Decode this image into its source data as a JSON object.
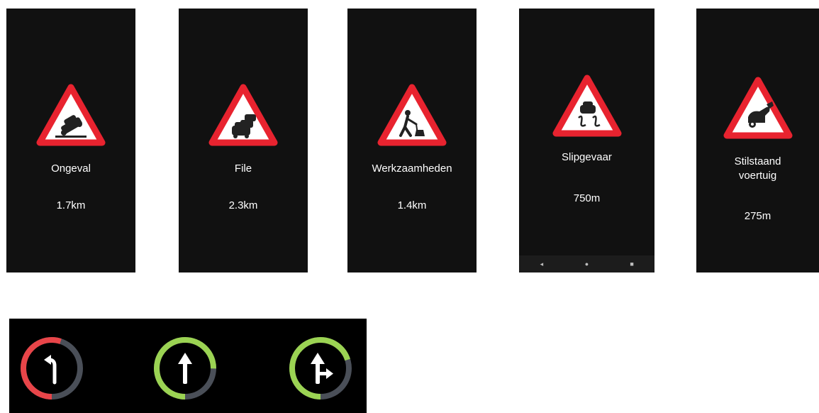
{
  "colors": {
    "card_bg": "#111111",
    "sign_red": "#e8232f",
    "ring_red": "#e84549",
    "ring_green": "#9bd353",
    "ring_track": "#4a4f58"
  },
  "warnings": [
    {
      "label": "Ongeval",
      "distance": "1.7km",
      "icon": "car-crash-icon"
    },
    {
      "label": "File",
      "distance": "2.3km",
      "icon": "traffic-jam-icon"
    },
    {
      "label": "Werkzaamheden",
      "distance": "1.4km",
      "icon": "roadworks-icon"
    },
    {
      "label": "Slipgevaar",
      "distance": "750m",
      "icon": "slippery-road-icon"
    },
    {
      "label": "Stilstaand\nvoertuig",
      "distance": "275m",
      "icon": "stationary-vehicle-icon"
    }
  ],
  "android_nav": {
    "back": "◂",
    "home": "●",
    "recents": "■"
  },
  "turn_indicators": [
    {
      "icon": "turn-left-arrow-icon",
      "ring_color": "red",
      "progress": 0.55
    },
    {
      "icon": "straight-arrow-icon",
      "ring_color": "green",
      "progress": 0.75
    },
    {
      "icon": "straight-or-right-arrow-icon",
      "ring_color": "green",
      "progress": 0.7
    }
  ]
}
